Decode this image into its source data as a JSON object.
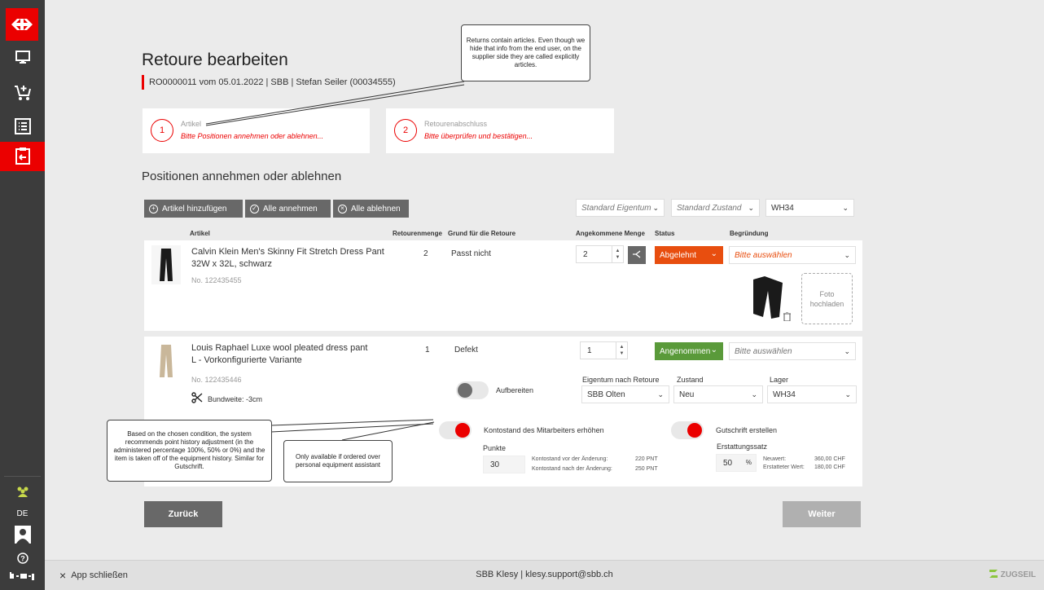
{
  "footer": {
    "close_label": "App schließen",
    "center_text": "SBB Klesy | klesy.support@sbb.ch",
    "brand": "ZUGSEIL"
  },
  "sidebar": {
    "language": "DE",
    "items": [
      {
        "icon": "monitor-icon"
      },
      {
        "icon": "cart-add-icon"
      },
      {
        "icon": "list-icon"
      },
      {
        "icon": "return-icon",
        "active": true
      }
    ]
  },
  "header": {
    "title": "Retoure bearbeiten",
    "subtitle": "RO0000011 vom 05.01.2022 | SBB | Stefan Seiler (00034555)"
  },
  "steps": [
    {
      "number": "1",
      "label": "Artikel",
      "hint": "Bitte Positionen annehmen oder ablehnen..."
    },
    {
      "number": "2",
      "label": "Retourenabschluss",
      "hint": "Bitte überprüfen und bestätigen..."
    }
  ],
  "section_title": "Positionen annehmen oder ablehnen",
  "toolbar": {
    "add_label": "Artikel hinzufügen",
    "accept_all_label": "Alle annehmen",
    "reject_all_label": "Alle ablehnen",
    "filter_owner": "Standard Eigentum",
    "filter_condition": "Standard Zustand",
    "filter_warehouse": "WH34"
  },
  "columns": {
    "article": "Artikel",
    "return_qty": "Retourenmenge",
    "reason": "Grund für die Retoure",
    "received_qty": "Angekommene Menge",
    "status": "Status",
    "justification": "Begründung"
  },
  "rows": [
    {
      "name_line1": "Calvin Klein Men's Skinny Fit Stretch Dress Pant",
      "name_line2": "32W x 32L, schwarz",
      "number": "No. 122435455",
      "return_qty": "2",
      "reason": "Passt nicht",
      "received_qty": "2",
      "status": "Abgelehnt",
      "status_color": "#e84e0f",
      "justification_placeholder": "Bitte auswählen",
      "upload_label_1": "Foto",
      "upload_label_2": "hochladen"
    },
    {
      "name_line1": "Louis Raphael Luxe wool pleated dress pant",
      "name_line2": "L - Vorkonfigurierte Variante",
      "number": "No. 122435446",
      "alteration": "Bundweite: -3cm",
      "return_qty": "1",
      "reason": "Defekt",
      "received_qty": "1",
      "status": "Angenommen",
      "status_color": "#5a9a3a",
      "justification_placeholder": "Bitte auswählen",
      "refurbish_label": "Aufbereiten",
      "owner_label": "Eigentum nach Retoure",
      "owner_value": "SBB Olten",
      "condition_label": "Zustand",
      "condition_value": "Neu",
      "warehouse_label": "Lager",
      "warehouse_value": "WH34",
      "account_toggle_label": "Kontostand des Mitarbeiters erhöhen",
      "points_label": "Punkte",
      "points_value": "30",
      "balance_before_label": "Kontostand vor der Änderung:",
      "balance_before_value": "220 PNT",
      "balance_after_label": "Kontostand nach der Änderung:",
      "balance_after_value": "250 PNT",
      "credit_toggle_label": "Gutschrift erstellen",
      "refund_rate_label": "Erstattungssatz",
      "refund_rate_value": "50",
      "refund_rate_unit": "%",
      "new_value_label": "Neuwert:",
      "new_value": "360,00 CHF",
      "refunded_label": "Erstatteter Wert:",
      "refunded_value": "180,00 CHF"
    }
  ],
  "callouts": {
    "articles": "Returns contain articles. Even though we hide that info from the end user, on the supplier side they are called explicitly articles.",
    "points": "Based on the chosen condition, the system recommends point history adjustment (in the administered percentage 100%, 50% or 0%) and the item is taken off of the equipment history. Similar for Gutschrift.",
    "personal": "Only available if ordered over personal equipment assistant"
  },
  "buttons": {
    "back": "Zurück",
    "next": "Weiter"
  },
  "colors": {
    "brand_red": "#eb0000",
    "sidebar": "#3c3c3c",
    "rejected": "#e84e0f",
    "accepted": "#5a9a3a"
  }
}
